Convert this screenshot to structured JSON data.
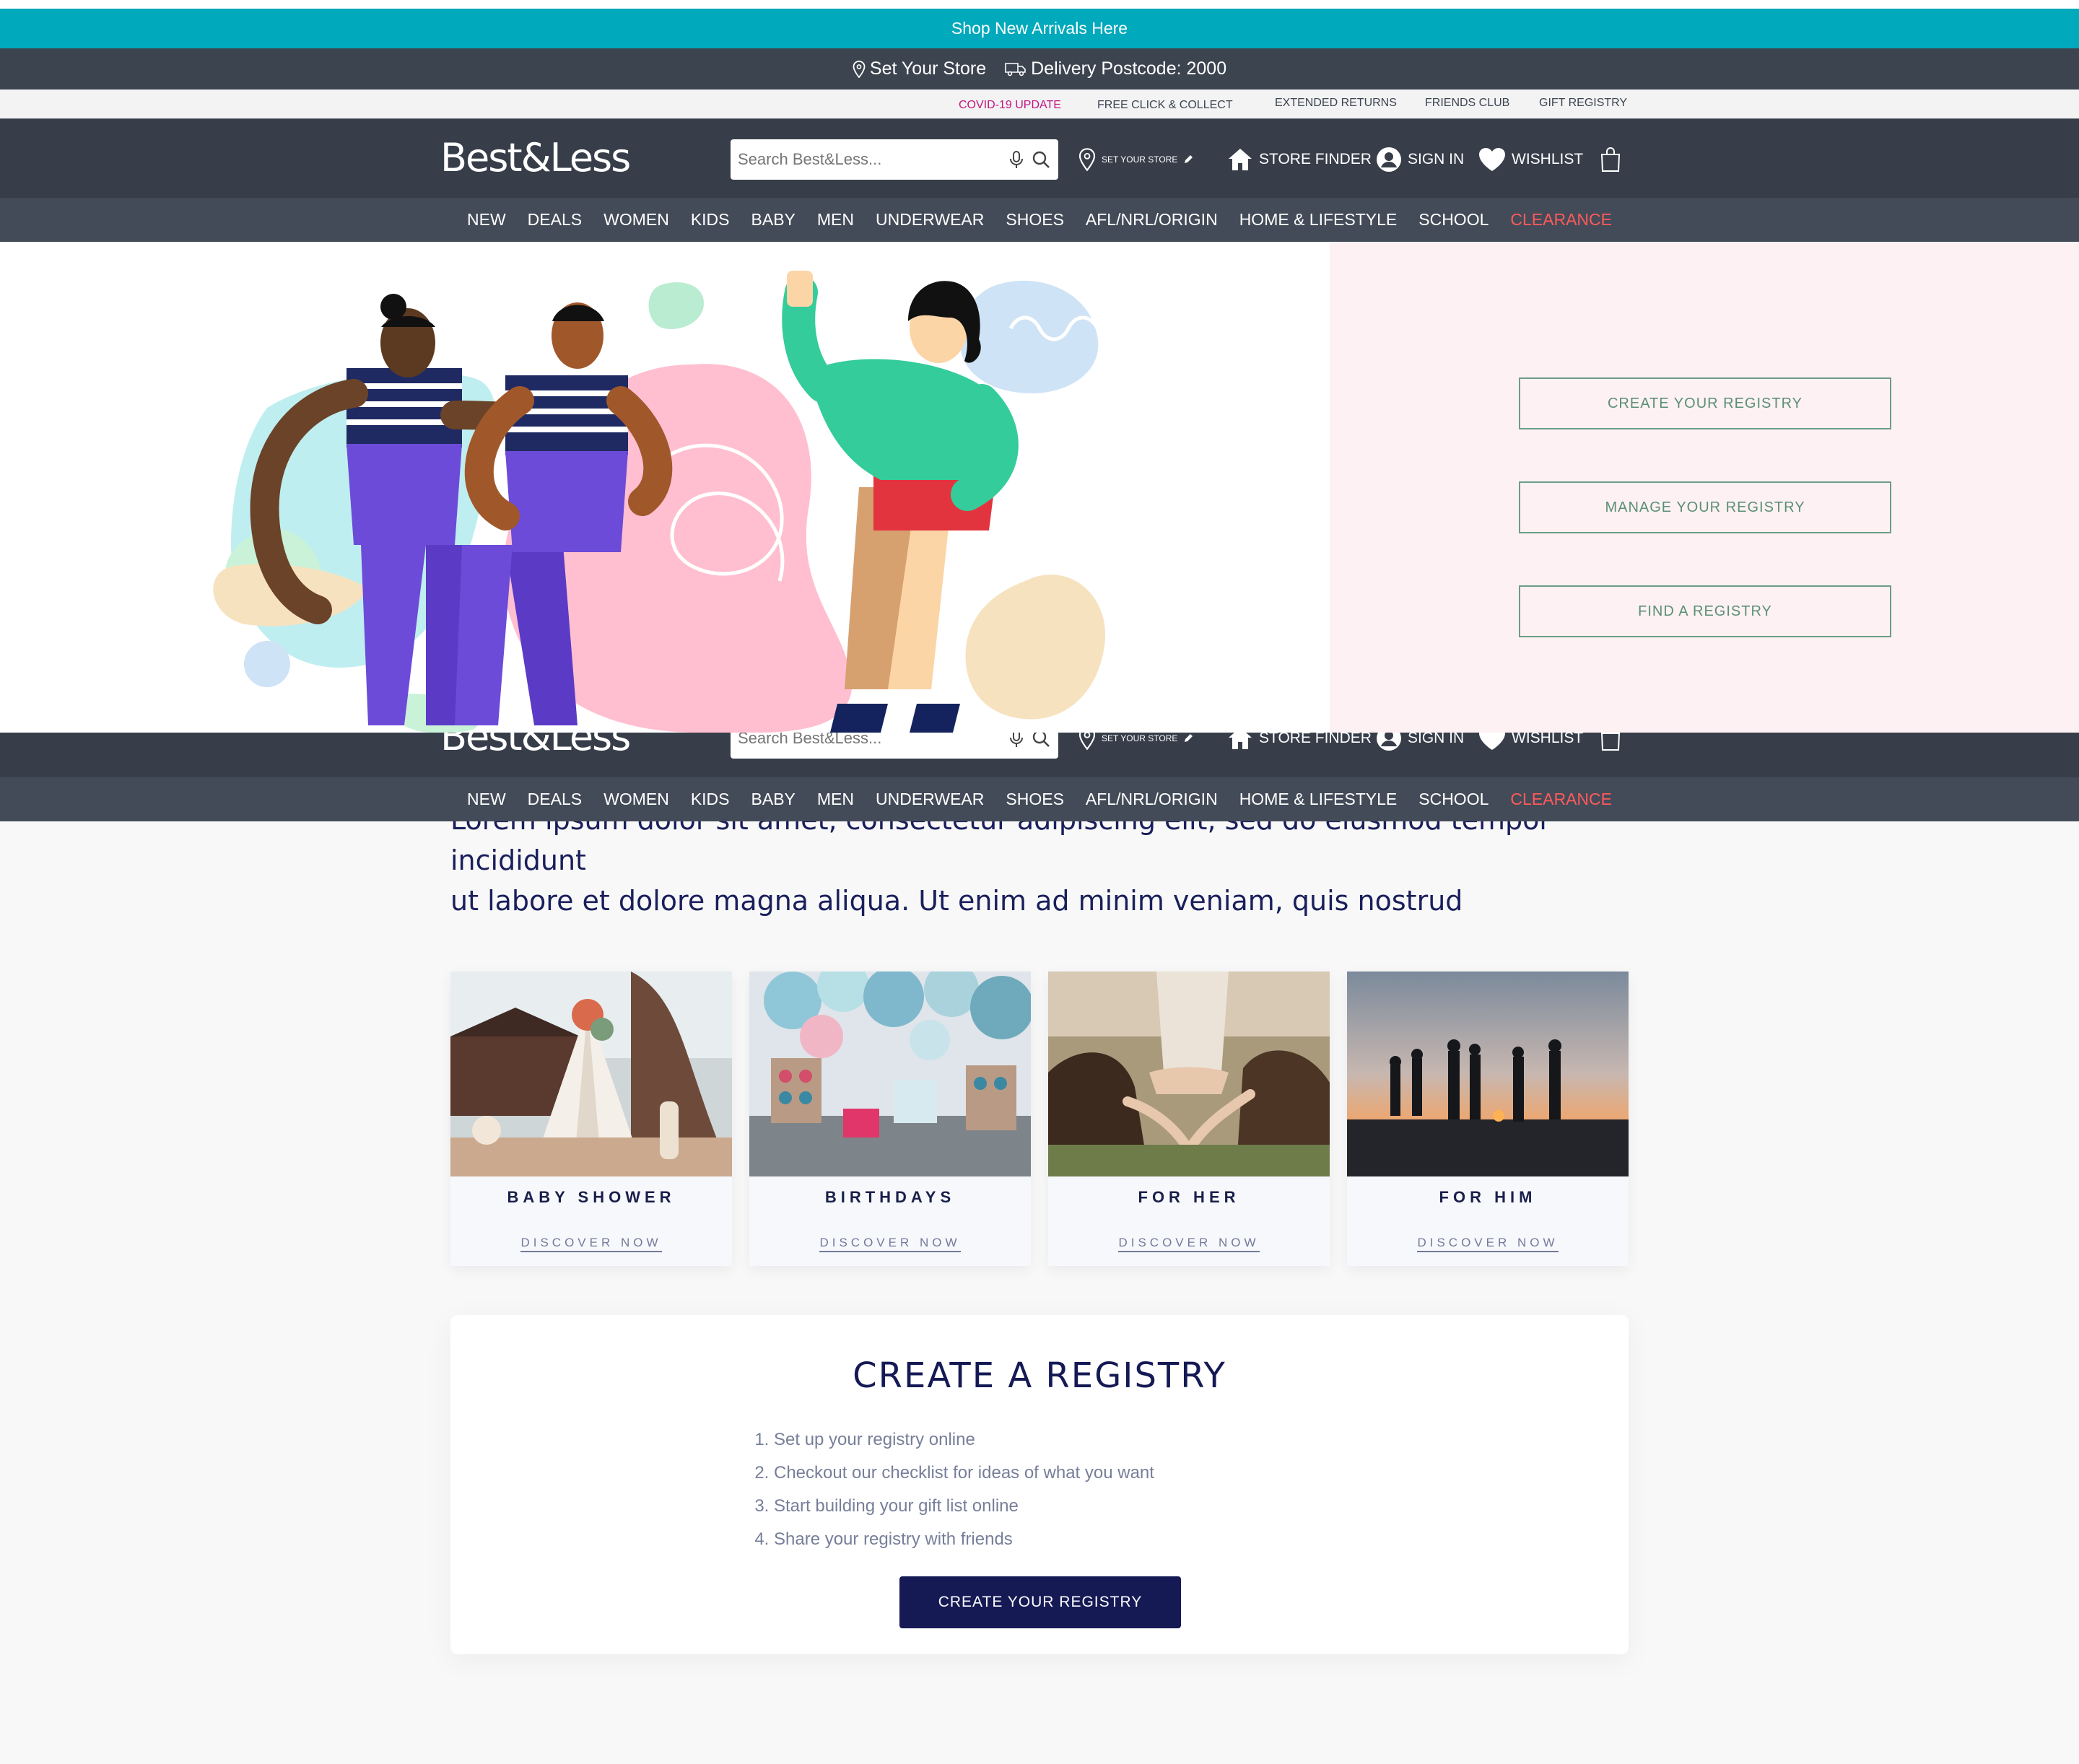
{
  "promo_bar": {
    "text": "Shop New Arrivals Here"
  },
  "delivery_bar": {
    "store_label": "Set Your Store",
    "postcode_label": "Delivery Postcode: 2000"
  },
  "utility_links": {
    "covid": "COVID-19 UPDATE",
    "click_collect": "FREE CLICK & COLLECT",
    "extended_returns": "EXTENDED RETURNS",
    "friends_club": "FRIENDS CLUB",
    "gift_registry": "GIFT REGISTRY"
  },
  "header": {
    "logo": "Best&Less",
    "search_placeholder": "Search Best&Less...",
    "set_your_store": "SET YOUR STORE",
    "store_finder": "STORE FINDER",
    "sign_in": "SIGN IN",
    "wishlist": "WISHLIST"
  },
  "nav": {
    "items": [
      "NEW",
      "DEALS",
      "WOMEN",
      "KIDS",
      "BABY",
      "MEN",
      "UNDERWEAR",
      "SHOES",
      "AFL/NRL/ORIGIN",
      "HOME & LIFESTYLE",
      "SCHOOL",
      "CLEARANCE"
    ]
  },
  "hero": {
    "buttons": [
      "CREATE YOUR REGISTRY",
      "MANAGE YOUR REGISTRY",
      "FIND A REGISTRY"
    ]
  },
  "intro": {
    "line1": "Lorem ipsum dolor sit amet, consectetur adipiscing elit, sed do eiusmod tempor incididunt",
    "line2": "ut labore et dolore magna aliqua. Ut enim ad minim veniam, quis nostrud"
  },
  "categories": [
    {
      "title": "BABY SHOWER",
      "link": "DISCOVER NOW"
    },
    {
      "title": "BIRTHDAYS",
      "link": "DISCOVER NOW"
    },
    {
      "title": "FOR HER",
      "link": "DISCOVER NOW"
    },
    {
      "title": "FOR HIM",
      "link": "DISCOVER NOW"
    }
  ],
  "create_registry": {
    "heading": "CREATE A REGISTRY",
    "steps": [
      "Set up your registry online",
      "Checkout our checklist for ideas of what you want",
      "Start building your gift list online",
      "Share your registry with friends"
    ],
    "button": "CREATE YOUR REGISTRY"
  },
  "colors": {
    "promo": "#00a9bb",
    "header": "#373e4a",
    "nav": "#434b58",
    "clearance": "#ff5a5a",
    "accent_navy": "#151a55",
    "registry_green": "#6a9e86",
    "hero_pink": "#fdf1f4"
  },
  "icons": [
    "pin-icon",
    "truck-icon",
    "mic-icon",
    "search-icon",
    "house-icon",
    "user-icon",
    "heart-icon",
    "bag-icon",
    "edit-icon"
  ]
}
